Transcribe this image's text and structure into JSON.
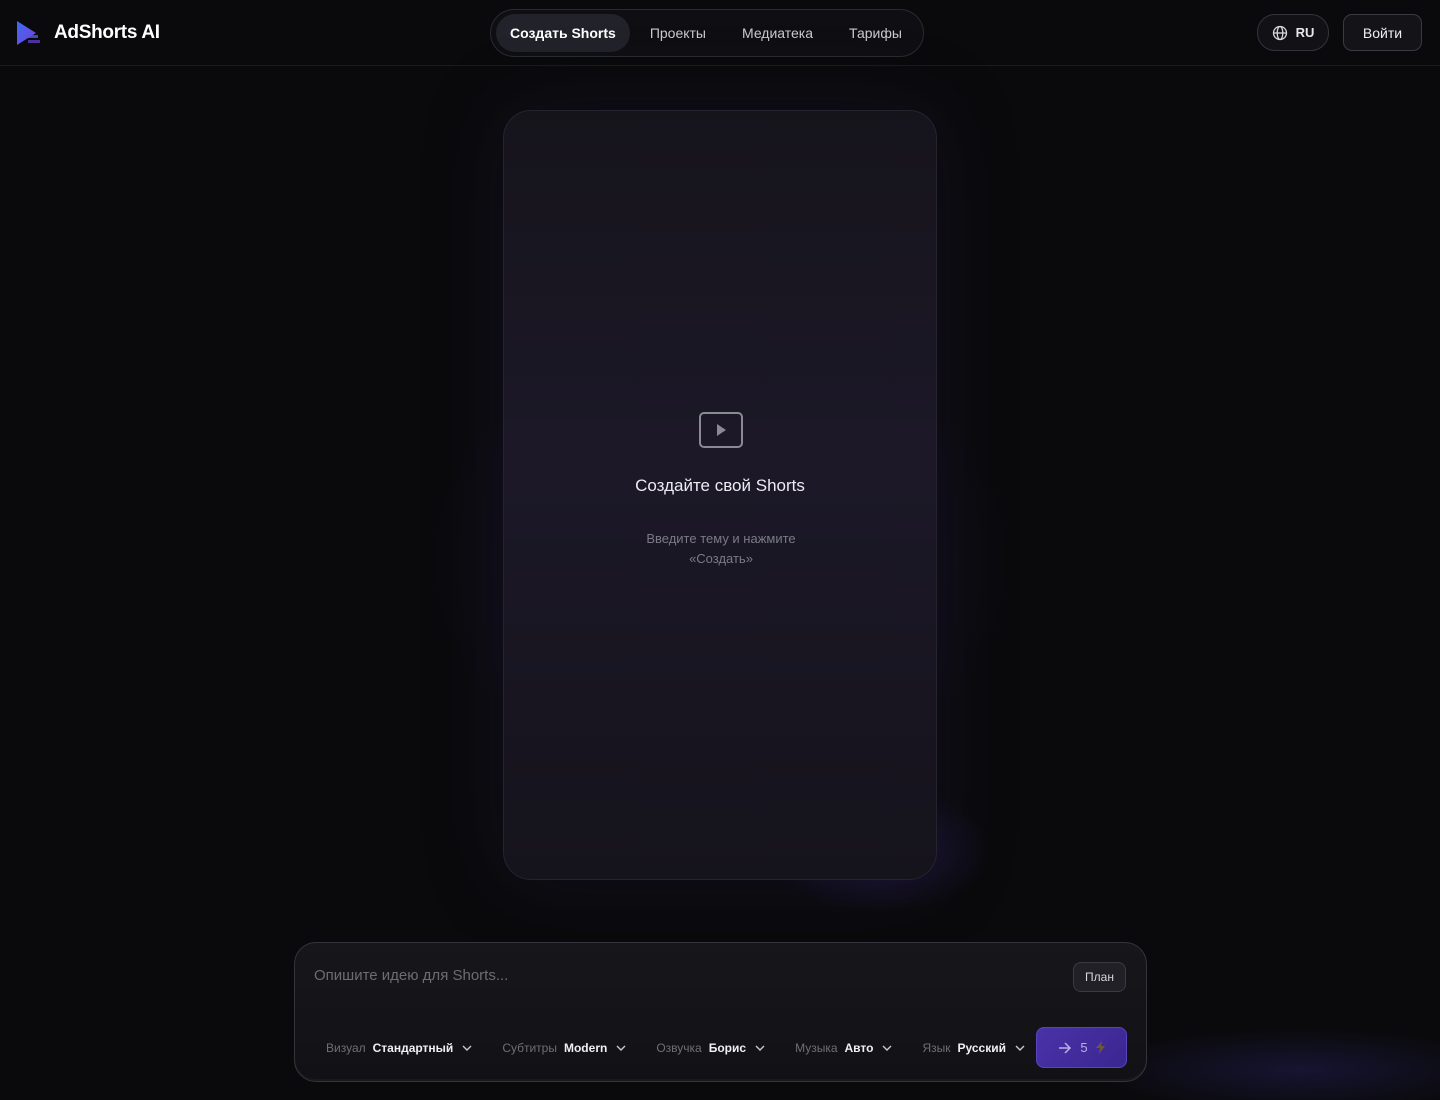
{
  "header": {
    "logo_text": "AdShorts AI",
    "nav": [
      {
        "label": "Создать Shorts",
        "active": true
      },
      {
        "label": "Проекты",
        "active": false
      },
      {
        "label": "Медиатека",
        "active": false
      },
      {
        "label": "Тарифы",
        "active": false
      }
    ],
    "language": "RU",
    "login_label": "Войти"
  },
  "preview": {
    "icon": "play-icon",
    "title": "Создайте свой Shorts",
    "subtitle": "Введите тему и нажмите «Создать»"
  },
  "prompt": {
    "placeholder": "Опишите идею для Shorts...",
    "plan_label": "План",
    "options": {
      "visual": {
        "label": "Визуал",
        "value": "Стандартный"
      },
      "subtitles": {
        "label": "Субтитры",
        "value": "Modern"
      },
      "voice": {
        "label": "Озвучка",
        "value": "Борис"
      },
      "music": {
        "label": "Музыка",
        "value": "Авто"
      },
      "language": {
        "label": "Язык",
        "value": "Русский"
      }
    },
    "submit": {
      "icon": "arrow-right-icon",
      "cost": "5",
      "cost_icon": "lightning-icon"
    }
  },
  "colors": {
    "background": "#0a0a0c",
    "accent": "#4a32a8",
    "lightning": "#6b5a3a"
  }
}
